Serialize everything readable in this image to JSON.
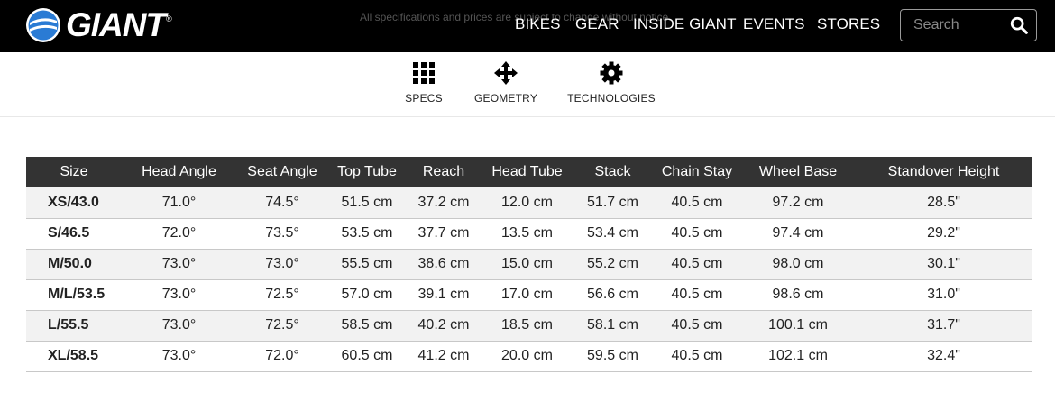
{
  "header": {
    "brand": "GIANT",
    "brand_mark": "®",
    "notice": "All specifications and prices are subject to change without notice.",
    "nav": [
      "BIKES",
      "GEAR",
      "INSIDE GIANT",
      "EVENTS",
      "STORES"
    ],
    "search_placeholder": "Search"
  },
  "subnav": {
    "items": [
      {
        "label": "SPECS",
        "icon": "grid-icon"
      },
      {
        "label": "GEOMETRY",
        "icon": "move-arrows-icon"
      },
      {
        "label": "TECHNOLOGIES",
        "icon": "gear-icon"
      }
    ]
  },
  "geometry_table": {
    "columns": [
      "Size",
      "Head Angle",
      "Seat Angle",
      "Top Tube",
      "Reach",
      "Head Tube",
      "Stack",
      "Chain Stay",
      "Wheel Base",
      "Standover Height"
    ],
    "rows": [
      [
        "XS/43.0",
        "71.0°",
        "74.5°",
        "51.5 cm",
        "37.2 cm",
        "12.0 cm",
        "51.7 cm",
        "40.5 cm",
        "97.2 cm",
        "28.5\""
      ],
      [
        "S/46.5",
        "72.0°",
        "73.5°",
        "53.5 cm",
        "37.7 cm",
        "13.5 cm",
        "53.4 cm",
        "40.5 cm",
        "97.4 cm",
        "29.2\""
      ],
      [
        "M/50.0",
        "73.0°",
        "73.0°",
        "55.5 cm",
        "38.6 cm",
        "15.0 cm",
        "55.2 cm",
        "40.5 cm",
        "98.0 cm",
        "30.1\""
      ],
      [
        "M/L/53.5",
        "73.0°",
        "72.5°",
        "57.0 cm",
        "39.1 cm",
        "17.0 cm",
        "56.6 cm",
        "40.5 cm",
        "98.6 cm",
        "31.0\""
      ],
      [
        "L/55.5",
        "73.0°",
        "72.5°",
        "58.5 cm",
        "40.2 cm",
        "18.5 cm",
        "58.1 cm",
        "40.5 cm",
        "100.1 cm",
        "31.7\""
      ],
      [
        "XL/58.5",
        "73.0°",
        "72.0°",
        "60.5 cm",
        "41.2 cm",
        "20.0 cm",
        "59.5 cm",
        "40.5 cm",
        "102.1 cm",
        "32.4\""
      ]
    ]
  },
  "colors": {
    "header_bg": "#000000",
    "table_header_bg": "#333333",
    "row_alt_bg": "#f2f2f2",
    "logo_blue": "#2a7bd4"
  }
}
